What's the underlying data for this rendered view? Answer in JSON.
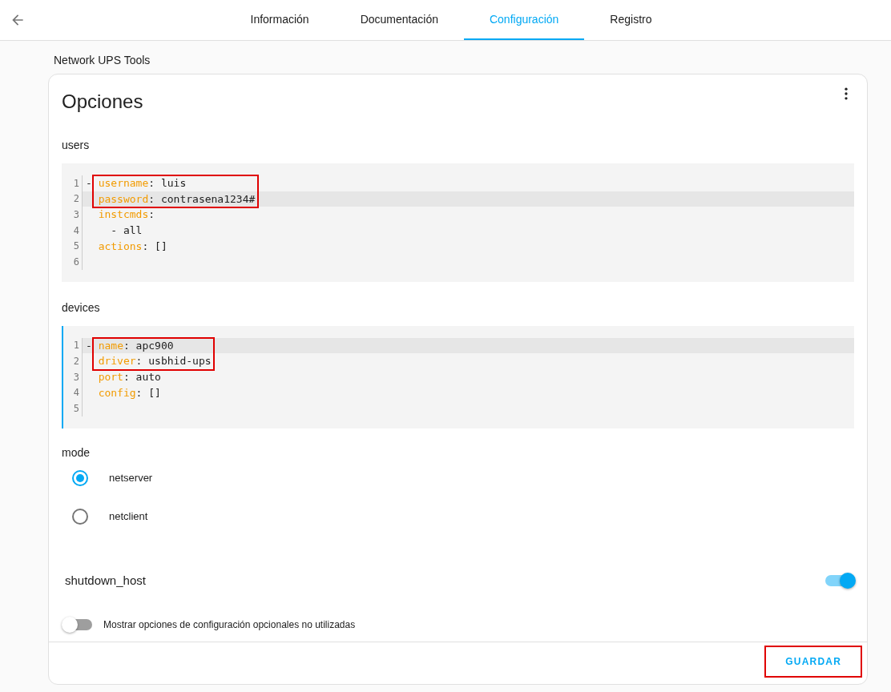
{
  "tabs": [
    {
      "label": "Información",
      "selected": false
    },
    {
      "label": "Documentación",
      "selected": false
    },
    {
      "label": "Configuración",
      "selected": true
    },
    {
      "label": "Registro",
      "selected": false
    }
  ],
  "breadcrumb": "Network UPS Tools",
  "card": {
    "title": "Opciones",
    "editors": [
      {
        "label": "users",
        "focused": false,
        "lines": [
          {
            "number": "1",
            "lead": "- ",
            "key": "username",
            "sep": ":",
            "value": " luis",
            "active": false,
            "highlighted": true
          },
          {
            "number": "2",
            "key": "password",
            "sep": ":",
            "value": " contrasena1234#",
            "active": true,
            "highlighted": true
          },
          {
            "number": "3",
            "key": "instcmds",
            "sep": ":",
            "active": false,
            "highlighted": false
          },
          {
            "number": "4",
            "lead": "    - ",
            "value": "all",
            "active": false,
            "highlighted": false
          },
          {
            "number": "5",
            "key": "actions",
            "sep": ":",
            "value": " []",
            "active": false,
            "highlighted": false
          },
          {
            "number": "6",
            "active": false,
            "highlighted": false
          }
        ]
      },
      {
        "label": "devices",
        "focused": true,
        "lines": [
          {
            "number": "1",
            "lead": "- ",
            "key": "name",
            "sep": ":",
            "value": " apc900",
            "active": true,
            "highlighted": true
          },
          {
            "number": "2",
            "key": "driver",
            "sep": ":",
            "value": " usbhid-ups",
            "active": false,
            "highlighted": true
          },
          {
            "number": "3",
            "key": "port",
            "sep": ":",
            "value": " auto",
            "active": false,
            "highlighted": false
          },
          {
            "number": "4",
            "key": "config",
            "sep": ":",
            "value": " []",
            "active": false,
            "highlighted": false
          },
          {
            "number": "5",
            "active": false,
            "highlighted": false
          }
        ]
      }
    ],
    "mode": {
      "label": "mode",
      "options": [
        {
          "label": "netserver",
          "selected": true
        },
        {
          "label": "netclient",
          "selected": false
        }
      ]
    },
    "shutdown": {
      "label": "shutdown_host",
      "on": true
    },
    "optional": {
      "label": "Mostrar opciones de configuración opcionales no utilizadas",
      "on": false
    },
    "save": {
      "label": "GUARDAR",
      "highlighted": true
    }
  }
}
